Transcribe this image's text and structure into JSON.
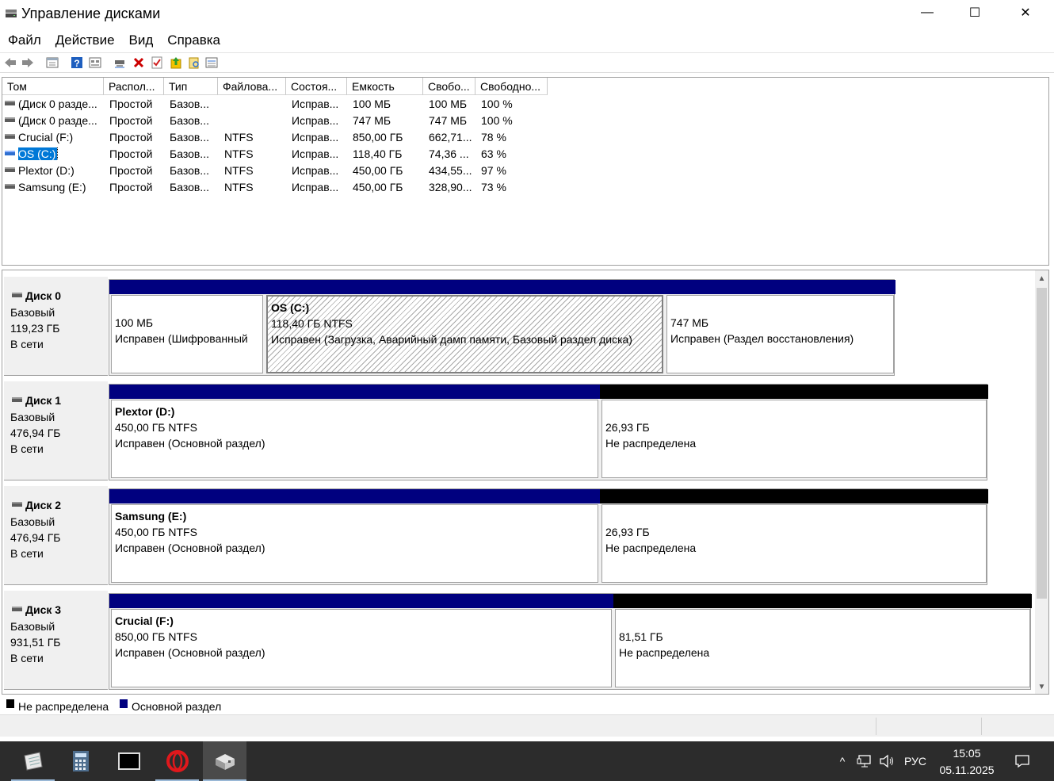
{
  "window": {
    "title": "Управление дисками",
    "controls": {
      "minimize": "—",
      "maximize": "☐",
      "close": "✕"
    }
  },
  "menu": [
    "Файл",
    "Действие",
    "Вид",
    "Справка"
  ],
  "toolbar": {
    "icons": [
      "back-icon",
      "forward-icon",
      "properties-icon",
      "help-icon",
      "view-icon",
      "connect-icon",
      "delete-icon",
      "check-icon",
      "up-icon",
      "search-icon",
      "list-icon"
    ],
    "colors": {
      "delete": "#cc0000",
      "help": "#1f5fbf",
      "up": "#f2c200"
    }
  },
  "volume_list": {
    "columns": [
      "Том",
      "Распол...",
      "Тип",
      "Файлова...",
      "Состоя...",
      "Емкость",
      "Свобо...",
      "Свободно..."
    ],
    "rows": [
      [
        "(Диск 0 разде...",
        "Простой",
        "Базов...",
        "",
        "Исправ...",
        "100 МБ",
        "100 МБ",
        "100 %"
      ],
      [
        "(Диск 0 разде...",
        "Простой",
        "Базов...",
        "",
        "Исправ...",
        "747 МБ",
        "747 МБ",
        "100 %"
      ],
      [
        "Crucial (F:)",
        "Простой",
        "Базов...",
        "NTFS",
        "Исправ...",
        "850,00 ГБ",
        "662,71...",
        "78 %"
      ],
      [
        "OS (C:)",
        "Простой",
        "Базов...",
        "NTFS",
        "Исправ...",
        "118,40 ГБ",
        "74,36 ...",
        "63 %"
      ],
      [
        "Plextor (D:)",
        "Простой",
        "Базов...",
        "NTFS",
        "Исправ...",
        "450,00 ГБ",
        "434,55...",
        "97 %"
      ],
      [
        "Samsung (E:)",
        "Простой",
        "Базов...",
        "NTFS",
        "Исправ...",
        "450,00 ГБ",
        "328,90...",
        "73 %"
      ]
    ],
    "selected_row": 3
  },
  "disks": [
    {
      "name": "Диск 0",
      "type": "Базовый",
      "size": "119,23 ГБ",
      "status": "В сети",
      "partitions": [
        {
          "bar": "blue",
          "name": "",
          "size": "100 МБ",
          "status": "Исправен (Шифрованный"
        },
        {
          "bar": "blue",
          "name": "OS  (C:)",
          "size": "118,40 ГБ NTFS",
          "status": "Исправен (Загрузка, Аварийный дамп памяти, Базовый раздел диска)",
          "selected": true
        },
        {
          "bar": "blue",
          "name": "",
          "size": "747 МБ",
          "status": "Исправен (Раздел восстановления)"
        }
      ]
    },
    {
      "name": "Диск 1",
      "type": "Базовый",
      "size": "476,94 ГБ",
      "status": "В сети",
      "partitions": [
        {
          "bar": "blue",
          "name": "Plextor  (D:)",
          "size": "450,00 ГБ NTFS",
          "status": "Исправен (Основной раздел)"
        },
        {
          "bar": "black",
          "name": "",
          "size": "26,93 ГБ",
          "status": "Не распределена"
        }
      ]
    },
    {
      "name": "Диск 2",
      "type": "Базовый",
      "size": "476,94 ГБ",
      "status": "В сети",
      "partitions": [
        {
          "bar": "blue",
          "name": "Samsung  (E:)",
          "size": "450,00 ГБ NTFS",
          "status": "Исправен (Основной раздел)"
        },
        {
          "bar": "black",
          "name": "",
          "size": "26,93 ГБ",
          "status": "Не распределена"
        }
      ]
    },
    {
      "name": "Диск 3",
      "type": "Базовый",
      "size": "931,51 ГБ",
      "status": "В сети",
      "partitions": [
        {
          "bar": "blue",
          "name": "Crucial  (F:)",
          "size": "850,00 ГБ NTFS",
          "status": "Исправен (Основной раздел)"
        },
        {
          "bar": "black",
          "name": "",
          "size": "81,51 ГБ",
          "status": "Не распределена"
        }
      ]
    }
  ],
  "legend": [
    {
      "label": "Не распределена",
      "color": "#000000"
    },
    {
      "label": "Основной раздел",
      "color": "#00007f"
    }
  ],
  "taskbar": {
    "apps": [
      "notepad-icon",
      "calculator-icon",
      "terminal-icon",
      "opera-icon",
      "disk-management-icon"
    ],
    "tray": {
      "chevron": "^",
      "lang": "РУС"
    },
    "time": "15:05",
    "date": "05.11.2025"
  }
}
